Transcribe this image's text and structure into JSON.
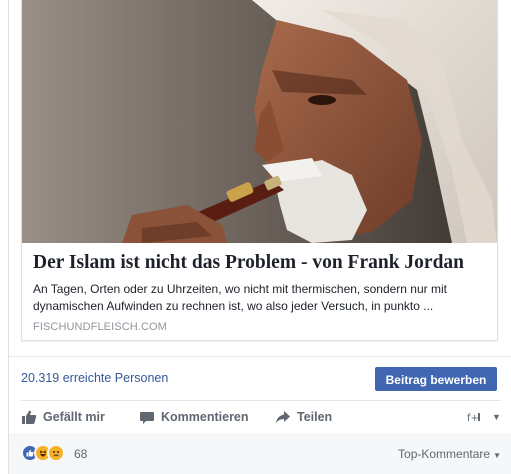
{
  "post": {
    "headline": "Der Islam ist nicht das Problem - von Frank Jordan",
    "description": "An Tagen, Orten oder zu Uhrzeiten, wo nicht mit thermischen, sondern nur mit dynamischen Aufwinden zu rechnen ist, wo also jeder Versuch, in punkto ...",
    "domain": "FISCHUNDFLEISCH.COM",
    "image_alt": "Older man with white beard and head wrap smoking a pipe"
  },
  "insights": {
    "reach_text": "20.319 erreichte Personen",
    "boost_label": "Beitrag bewerben"
  },
  "actions": {
    "like_label": "Gefällt mir",
    "comment_label": "Kommentieren",
    "share_label": "Teilen"
  },
  "reactions": {
    "count": "68",
    "sort_label": "Top-Kommentare",
    "icons": [
      "like-icon",
      "haha-icon",
      "sad-icon"
    ]
  },
  "colors": {
    "link_blue": "#365899",
    "button_blue": "#4267b2",
    "muted_gray": "#90949c",
    "action_gray": "#606770"
  }
}
